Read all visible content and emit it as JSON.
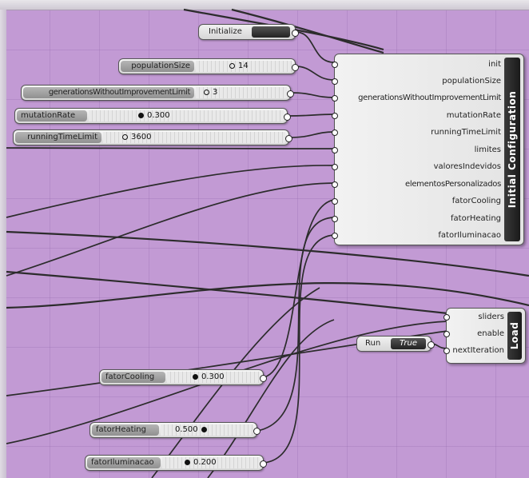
{
  "button": {
    "label": "Initialize"
  },
  "sliders": [
    {
      "label": "populationSize",
      "value": "14"
    },
    {
      "label": "generationsWithoutImprovementLimit",
      "value": "3"
    },
    {
      "label": "mutationRate",
      "value": "0.300"
    },
    {
      "label": "runningTimeLimit",
      "value": "3600"
    },
    {
      "label": "fatorCooling",
      "value": "0.300"
    },
    {
      "label": "fatorHeating",
      "value": "0.500"
    },
    {
      "label": "fatorIluminacao",
      "value": "0.200"
    }
  ],
  "initial_config": {
    "title": "Initial Configuration",
    "inputs": [
      "init",
      "populationSize",
      "generationsWithoutImprovementLimit",
      "mutationRate",
      "runningTimeLimit",
      "limites",
      "valoresIndevidos",
      "elementosPersonalizados",
      "fatorCooling",
      "fatorHeating",
      "fatorIluminacao"
    ]
  },
  "load": {
    "title": "Load",
    "inputs": [
      "sliders",
      "enable",
      "nextIteration"
    ]
  },
  "toggle": {
    "label": "Run",
    "state": "True"
  },
  "colors": {
    "canvas": "#c29ad4",
    "wire": "#2c2c2c"
  }
}
